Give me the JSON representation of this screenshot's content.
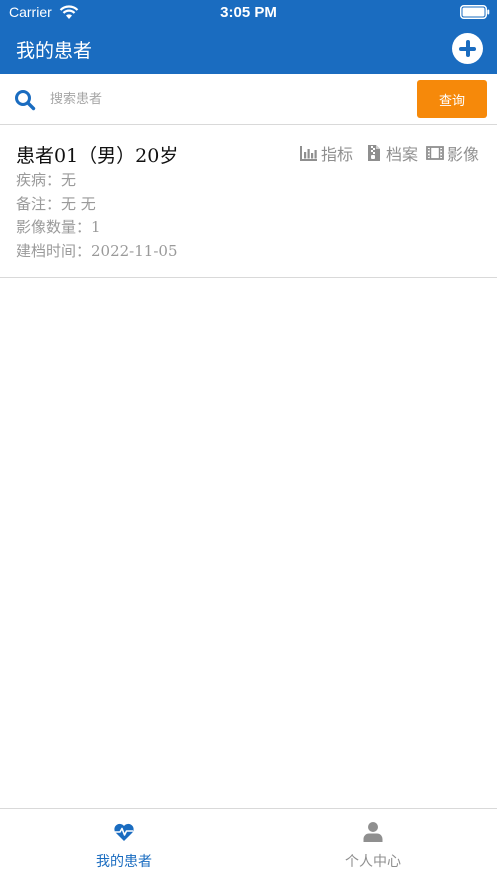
{
  "status_bar": {
    "carrier": "Carrier",
    "time": "3:05 PM"
  },
  "nav": {
    "title": "我的患者"
  },
  "search": {
    "placeholder": "搜索患者",
    "query_label": "查询"
  },
  "patient": {
    "title": "患者01（男）20岁",
    "disease": "疾病：无",
    "note": "备注：无 无",
    "image_count": "影像数量：1",
    "created": "建档时间：2022-11-05",
    "actions": {
      "indicators": "指标",
      "files": "档案",
      "images": "影像"
    }
  },
  "tabs": {
    "my_patients": "我的患者",
    "profile": "个人中心"
  },
  "colors": {
    "primary": "#1a6cc0",
    "accent": "#f6890a",
    "muted": "#8f8f8f"
  }
}
